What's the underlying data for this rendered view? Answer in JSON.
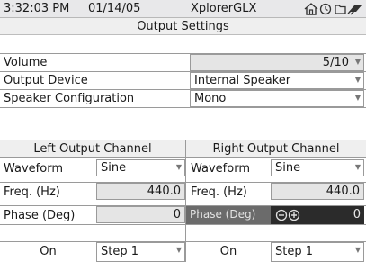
{
  "status": {
    "time": "3:32:03 PM",
    "date": "01/14/05",
    "app": "XplorerGLX"
  },
  "title": "Output Settings",
  "settings": {
    "volume_label": "Volume",
    "volume_value": "5/10",
    "device_label": "Output Device",
    "device_value": "Internal Speaker",
    "speaker_label": "Speaker Configuration",
    "speaker_value": "Mono"
  },
  "left": {
    "header": "Left Output Channel",
    "waveform_label": "Waveform",
    "waveform_value": "Sine",
    "freq_label": "Freq. (Hz)",
    "freq_value": "440.0",
    "phase_label": "Phase (Deg)",
    "phase_value": "0",
    "toggle": "On",
    "step": "Step 1"
  },
  "right": {
    "header": "Right Output Channel",
    "waveform_label": "Waveform",
    "waveform_value": "Sine",
    "freq_label": "Freq. (Hz)",
    "freq_value": "440.0",
    "phase_label": "Phase (Deg)",
    "phase_value": "0",
    "toggle": "On",
    "step": "Step 1"
  },
  "icons": [
    "home-icon",
    "clock-icon",
    "folder-icon",
    "battery-plug-icon"
  ]
}
